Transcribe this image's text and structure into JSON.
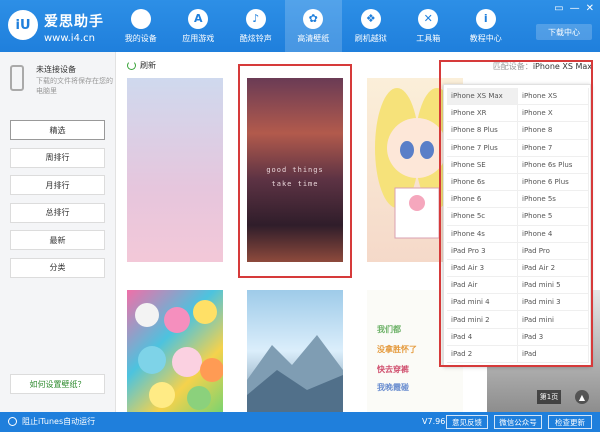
{
  "header": {
    "logo_text": "iU",
    "brand_name": "爱思助手",
    "brand_url": "www.i4.cn",
    "nav": [
      {
        "label": "我的设备",
        "icon": "apple-icon",
        "glyph": ""
      },
      {
        "label": "应用游戏",
        "icon": "appstore-icon",
        "glyph": "A"
      },
      {
        "label": "酷炫铃声",
        "icon": "bell-icon",
        "glyph": "♪"
      },
      {
        "label": "高清壁纸",
        "icon": "flower-icon",
        "glyph": "✿"
      },
      {
        "label": "刷机越狱",
        "icon": "dropbox-icon",
        "glyph": "❖"
      },
      {
        "label": "工具箱",
        "icon": "tools-icon",
        "glyph": "✕"
      },
      {
        "label": "教程中心",
        "icon": "info-icon",
        "glyph": "i"
      }
    ],
    "active_nav": 3,
    "window_controls": [
      "▭",
      "—",
      "✕"
    ],
    "download_label": "下载中心"
  },
  "sidebar": {
    "device_title": "未连接设备",
    "device_desc": "下载的文件将保存在您的电脑里",
    "menu": [
      "精选",
      "周排行",
      "月排行",
      "总排行",
      "最新",
      "分类"
    ],
    "active_index": 0,
    "howto_label": "如何设置壁纸？"
  },
  "content": {
    "refresh_label": "刷新",
    "filter_label": "匹配设备：",
    "filter_value": "iPhone XS Max",
    "wallpaper_text_1": "good things",
    "wallpaper_text_2": "take time",
    "handwriting_lines": [
      "我们都",
      "没拿胜怀了",
      "快去穿裤",
      "我晚霞碰"
    ],
    "page_label": "第1页",
    "up_label": "▲"
  },
  "device_list": {
    "selected": "iPhone XS Max",
    "items": [
      "iPhone XS Max",
      "iPhone XS",
      "iPhone XR",
      "iPhone X",
      "iPhone 8 Plus",
      "iPhone 8",
      "iPhone 7 Plus",
      "iPhone 7",
      "iPhone SE",
      "iPhone 6s Plus",
      "iPhone 6s",
      "iPhone 6 Plus",
      "iPhone 6",
      "iPhone 5s",
      "iPhone 5c",
      "iPhone 5",
      "iPhone 4s",
      "iPhone 4",
      "iPad Pro 3",
      "iPad Pro",
      "iPad Air 3",
      "iPad Air 2",
      "iPad Air",
      "iPad mini 5",
      "iPad mini 4",
      "iPad mini 3",
      "iPad mini 2",
      "iPad mini",
      "iPad 4",
      "iPad 3",
      "iPad 2",
      "iPad"
    ]
  },
  "statusbar": {
    "itunes_label": "阻止iTunes自动运行",
    "version": "V7.96",
    "buttons": [
      "意见反馈",
      "微信公众号",
      "检查更新"
    ]
  },
  "colors": {
    "brand_blue": "#1f7fdc",
    "highlight_red": "#d63a3a",
    "howto_green": "#2e8b2e"
  }
}
